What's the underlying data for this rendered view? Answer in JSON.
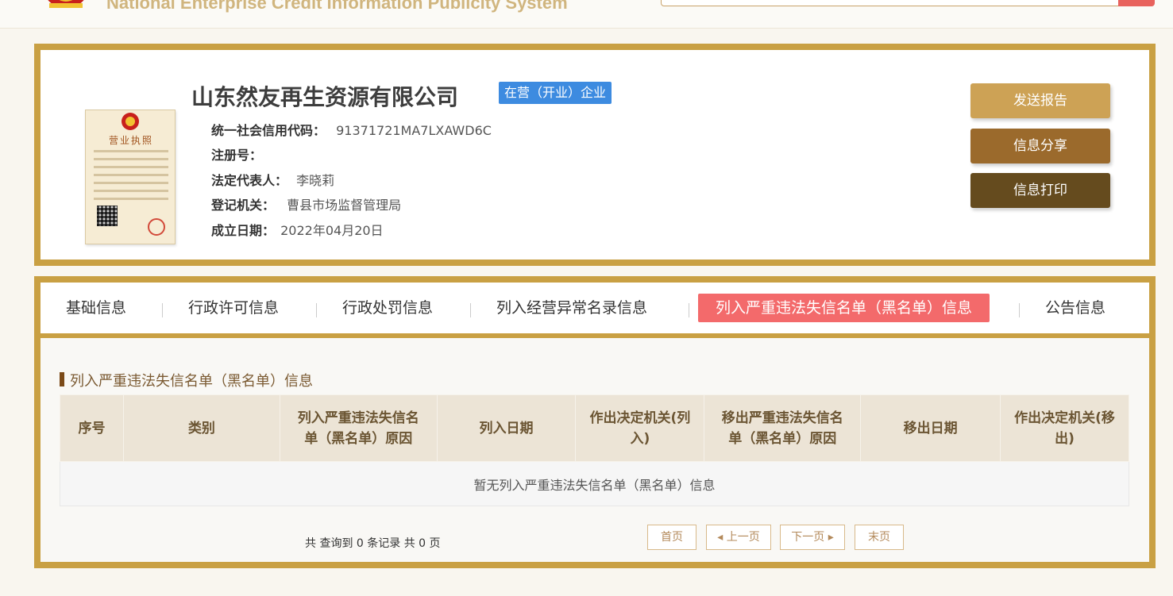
{
  "header": {
    "site_title": "National Enterprise Credit Information Publicity System"
  },
  "company": {
    "name": "山东然友再生资源有限公司",
    "status": "在营（开业）企业",
    "license_title": "营业执照",
    "fields": [
      {
        "label": "统一社会信用代码：",
        "value": "91371721MA7LXAWD6C"
      },
      {
        "label": "注册号：",
        "value": ""
      },
      {
        "label": "法定代表人：",
        "value": "李晓莉"
      },
      {
        "label": "登记机关：",
        "value": "曹县市场监督管理局"
      },
      {
        "label": "成立日期：",
        "value": "2022年04月20日"
      }
    ]
  },
  "actions": {
    "send_report": "发送报告",
    "share": "信息分享",
    "print": "信息打印"
  },
  "tabs": [
    {
      "label": "基础信息",
      "active": false
    },
    {
      "label": "行政许可信息",
      "active": false
    },
    {
      "label": "行政处罚信息",
      "active": false
    },
    {
      "label": "列入经营异常名录信息",
      "active": false
    },
    {
      "label": "列入严重违法失信名单（黑名单）信息",
      "active": true
    },
    {
      "label": "公告信息",
      "active": false
    }
  ],
  "section": {
    "title": "列入严重违法失信名单（黑名单）信息",
    "columns": [
      "序号",
      "类别",
      "列入严重违法失信名单（黑名单）原因",
      "列入日期",
      "作出决定机关(列入)",
      "移出严重违法失信名单（黑名单）原因",
      "移出日期",
      "作出决定机关(移出)"
    ],
    "empty_message": "暂无列入严重违法失信名单（黑名单）信息"
  },
  "pagination": {
    "summary": "共 查询到 0 条记录 共 0 页",
    "first": "首页",
    "prev": "◂ 上一页",
    "next": "下一页 ▸",
    "last": "末页"
  },
  "colors": {
    "gold_border": "#c9a043",
    "active_tab": "#f36a6b",
    "status_blue": "#3d8be0"
  }
}
